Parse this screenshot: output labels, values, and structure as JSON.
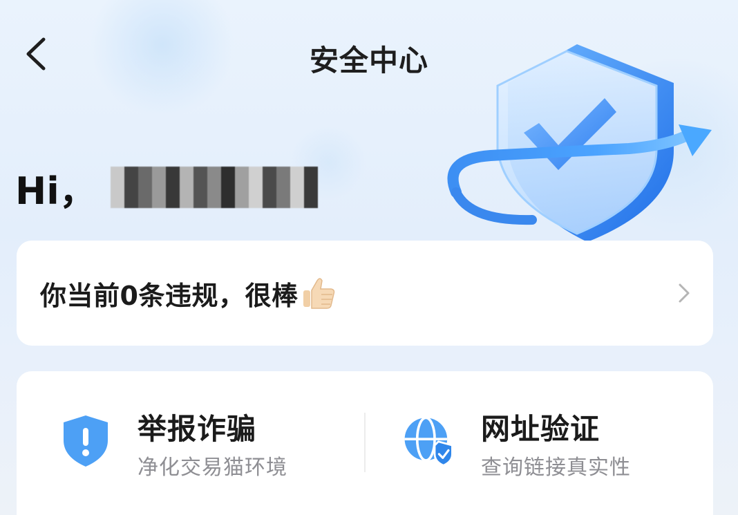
{
  "header": {
    "title": "安全中心",
    "back_icon": "chevron-left-icon"
  },
  "greeting": {
    "hi": "Hi，",
    "username_state": "pixelated"
  },
  "violations": {
    "text": "你当前0条违规，很棒",
    "emoji_icon": "thumbs-up-icon",
    "chevron_icon": "chevron-right-icon"
  },
  "features": [
    {
      "title": "举报诈骗",
      "subtitle": "净化交易猫环境",
      "icon": "shield-alert-icon"
    },
    {
      "title": "网址验证",
      "subtitle": "查询链接真实性",
      "icon": "globe-check-icon"
    }
  ],
  "colors": {
    "accent": "#3c8ef0",
    "icon_blue": "#4da0f5",
    "text_primary": "#1b1b1b",
    "text_secondary": "#8e8e93"
  }
}
